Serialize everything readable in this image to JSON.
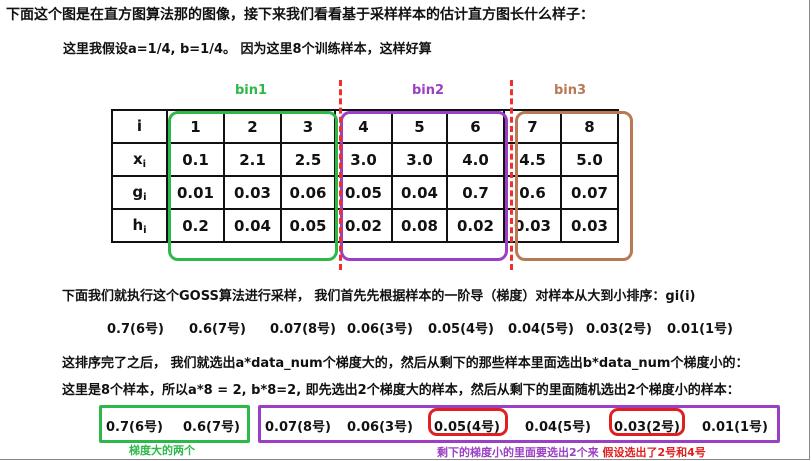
{
  "intro": {
    "title": "下面这个图是在直方图算法那的图像，接下来我们看看基于采样样本的估计直方图长什么样子：",
    "assumption": "这里我假设a=1/4, b=1/4。  因为这里8个训练样本，这样好算"
  },
  "bins": [
    "bin1",
    "bin2",
    "bin3"
  ],
  "colors": {
    "bin1": "#2db84a",
    "bin2": "#9b3fc4",
    "bin3": "#b87a55",
    "divider": "#ee3030",
    "highlight": "#e02020"
  },
  "table": {
    "rows": [
      {
        "label": "i",
        "sub": "",
        "cells": [
          "1",
          "2",
          "3",
          "4",
          "5",
          "6",
          "7",
          "8"
        ]
      },
      {
        "label": "x",
        "sub": "i",
        "cells": [
          "0.1",
          "2.1",
          "2.5",
          "3.0",
          "3.0",
          "4.0",
          "4.5",
          "5.0"
        ]
      },
      {
        "label": "g",
        "sub": "i",
        "cells": [
          "0.01",
          "0.03",
          "0.06",
          "0.05",
          "0.04",
          "0.7",
          "0.6",
          "0.07"
        ]
      },
      {
        "label": "h",
        "sub": "i",
        "cells": [
          "0.2",
          "0.04",
          "0.05",
          "0.02",
          "0.08",
          "0.02",
          "0.03",
          "0.03"
        ]
      }
    ]
  },
  "goss": {
    "text": "下面我们就执行这个GOSS算法进行采样，  我们首先先根据样本的一阶导（梯度）对样本从大到小排序：gi(i)",
    "sorted": [
      "0.7(6号)",
      "0.6(7号)",
      "0.07(8号)",
      "0.06(3号)",
      "0.05(4号)",
      "0.04(5号)",
      "0.03(2号)",
      "0.01(1号)"
    ]
  },
  "selection": {
    "line1": "这排序完了之后，  我们就选出a*data_num个梯度大的，然后从剩下的那些样本里面选出b*data_num个梯度小的：",
    "line2": "这里是8个样本，所以a*8 = 2, b*8=2, 即先选出2个梯度大的样本，然后从剩下的里面随机选出2个梯度小的样本："
  },
  "result": {
    "large": [
      "0.7(6号)",
      "0.6(7号)"
    ],
    "small": [
      "0.07(8号)",
      "0.06(3号)",
      "0.05(4号)",
      "0.04(5号)",
      "0.03(2号)",
      "0.01(1号)"
    ],
    "large_caption": "梯度大的两个",
    "small_caption_a": "剩下的梯度小的里面要选出2个来",
    "small_caption_b": "假设选出了2号和4号"
  }
}
